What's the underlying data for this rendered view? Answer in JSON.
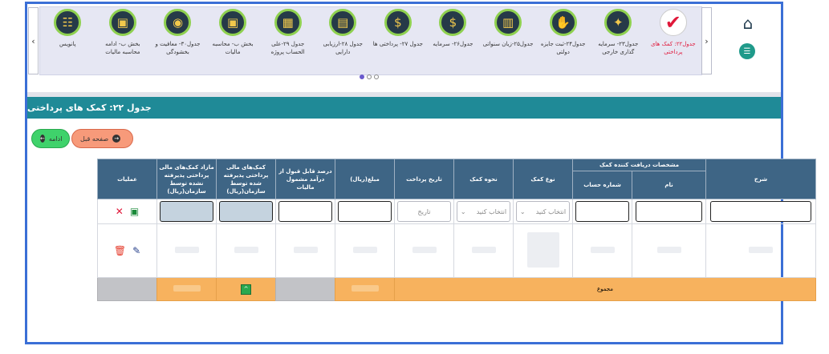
{
  "topnav": {
    "items": [
      {
        "label": "جدول۲۲: کمک های پرداختی",
        "icon": "check-icon",
        "selected": true
      },
      {
        "label": "جدول۲۳- سرمایه گذاری خارجی",
        "icon": "bulb-coins-icon"
      },
      {
        "label": "جدول۲۴-ثبت جایزه دولتی",
        "icon": "handshake-icon"
      },
      {
        "label": "جدول۲۵-زیان سنواتی",
        "icon": "chart-loss-icon"
      },
      {
        "label": "جدول۲۶- سرمایه",
        "icon": "moneybag-icon"
      },
      {
        "label": "جدول ۲۷- پرداختی ها",
        "icon": "payment-icon"
      },
      {
        "label": "جدول ۲۸-ارزیابی دارایی",
        "icon": "asset-icon"
      },
      {
        "label": "جدول ۲۹-علی الحساب پروژه",
        "icon": "project-icon"
      },
      {
        "label": "بخش ب- محاسبه مالیات",
        "icon": "tax-calc-icon"
      },
      {
        "label": "جدول۳۰- معافیت و بخشودگی",
        "icon": "exemption-icon"
      },
      {
        "label": "بخش ب- ادامه محاسبه مالیات",
        "icon": "tax-cont-icon"
      },
      {
        "label": "پانویس",
        "icon": "footnote-icon"
      }
    ]
  },
  "page": {
    "title": "جدول ۲۲: کمک های پرداختی"
  },
  "buttons": {
    "prev": "صفحه قبل",
    "next": "ادامه"
  },
  "table": {
    "headers": {
      "desc": "شرح",
      "recipient": "مشخصات دریافت کننده کمک",
      "name": "نام",
      "account": "شماره حساب",
      "type": "نوع کمک",
      "method": "نحوه کمک",
      "date": "تاریخ پرداخت",
      "amount": "مبلغ(ریال)",
      "percent": "درصد قابل قبول از درآمد مشمول مالیات",
      "accepted": "کمک‌های مالی پرداختی پذیرفته شده توسط سازمان(ریال)",
      "excess": "مازاد کمک‌های مالی پرداختی پذیرفته نشده توسط سازمان(ریال)",
      "ops": "عملیات"
    },
    "placeholders": {
      "select": "انتخاب کنید",
      "date": "تاریخ"
    },
    "sum_label": "مجموع"
  }
}
